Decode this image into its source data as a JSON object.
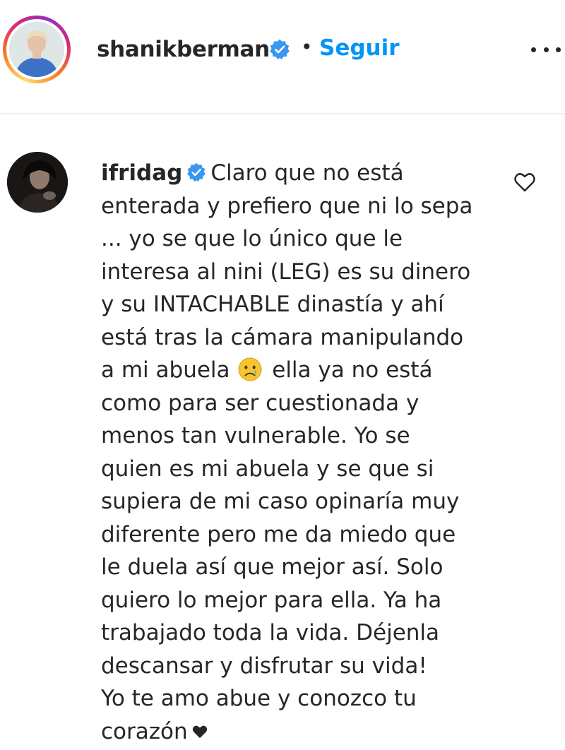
{
  "post_header": {
    "username": "shanikberman",
    "separator": "•",
    "follow_label": "Seguir"
  },
  "comment": {
    "username": "ifridag",
    "lines": [
      "Claro que no está",
      "enterada y prefiero que ni lo sepa",
      "... yo se que lo único que le",
      "interesa al nini (LEG) es su dinero",
      "y su INTACHABLE dinastía y ahí",
      "está tras la cámara manipulando",
      "a mi abuela",
      "ella ya no está",
      "como para ser cuestionada y",
      "menos tan vulnerable. Yo se",
      "quien es mi abuela y se que si",
      "supiera de mi caso opinaría muy",
      "diferente pero me da miedo que",
      "le duela así que mejor así. Solo",
      "quiero lo mejor para ella. Ya ha",
      "trabajado toda la vida. Déjenla",
      "descansar y disfrutar su vida!",
      "Yo te amo abue y conozco tu",
      "corazón"
    ],
    "emoji_icon": "crying-face-icon",
    "heart_icon": "black-heart-icon"
  },
  "icons": {
    "verified": "verified-badge-icon",
    "more": "more-options-icon",
    "like": "heart-outline-icon"
  },
  "colors": {
    "accent_blue": "#0095f6",
    "verified_blue": "#3897f0",
    "text": "#262626"
  }
}
